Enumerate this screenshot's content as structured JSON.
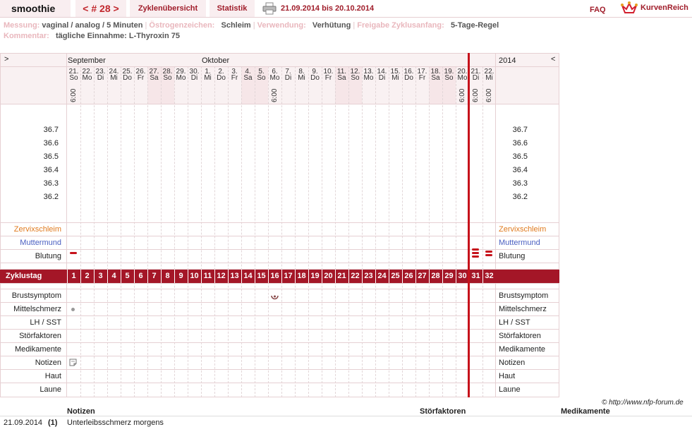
{
  "header": {
    "brand": "smoothie",
    "cycle_nav": {
      "prev": "<",
      "label": "# 28",
      "next": ">"
    },
    "tabs": [
      {
        "label": "Zyklenübersicht"
      },
      {
        "label": "Statistik"
      }
    ],
    "date_range": "21.09.2014 bis 20.10.2014",
    "faq": "FAQ",
    "logo_text": "KurvenReich"
  },
  "info": {
    "measurement_label": "Messung:",
    "measurement_value": "vaginal / analog / 5 Minuten",
    "estrogen_label": "Östrogenzeichen:",
    "estrogen_value": "Schleim",
    "use_label": "Verwendung:",
    "use_value": "Verhütung",
    "release_label": "Freigabe Zyklusanfang:",
    "release_value": "5-Tage-Regel",
    "comment_label": "Kommentar:",
    "comment_value": "tägliche Einnahme: L-Thyroxin 75"
  },
  "chart": {
    "nav_left": ">",
    "nav_right": "<",
    "year": "2014",
    "months": [
      "September",
      "Oktober"
    ],
    "days": [
      {
        "d": "21.",
        "w": "So",
        "t": "6:00"
      },
      {
        "d": "22.",
        "w": "Mo",
        "t": ""
      },
      {
        "d": "23.",
        "w": "Di",
        "t": ""
      },
      {
        "d": "24.",
        "w": "Mi",
        "t": ""
      },
      {
        "d": "25.",
        "w": "Do",
        "t": ""
      },
      {
        "d": "26.",
        "w": "Fr",
        "t": ""
      },
      {
        "d": "27.",
        "w": "Sa",
        "t": ""
      },
      {
        "d": "28.",
        "w": "So",
        "t": ""
      },
      {
        "d": "29.",
        "w": "Mo",
        "t": ""
      },
      {
        "d": "30.",
        "w": "Di",
        "t": ""
      },
      {
        "d": "1.",
        "w": "Mi",
        "t": ""
      },
      {
        "d": "2.",
        "w": "Do",
        "t": ""
      },
      {
        "d": "3.",
        "w": "Fr",
        "t": ""
      },
      {
        "d": "4.",
        "w": "Sa",
        "t": ""
      },
      {
        "d": "5.",
        "w": "So",
        "t": ""
      },
      {
        "d": "6.",
        "w": "Mo",
        "t": "6:00"
      },
      {
        "d": "7.",
        "w": "Di",
        "t": ""
      },
      {
        "d": "8.",
        "w": "Mi",
        "t": ""
      },
      {
        "d": "9.",
        "w": "Do",
        "t": ""
      },
      {
        "d": "10.",
        "w": "Fr",
        "t": ""
      },
      {
        "d": "11.",
        "w": "Sa",
        "t": ""
      },
      {
        "d": "12.",
        "w": "So",
        "t": ""
      },
      {
        "d": "13.",
        "w": "Mo",
        "t": ""
      },
      {
        "d": "14.",
        "w": "Di",
        "t": ""
      },
      {
        "d": "15.",
        "w": "Mi",
        "t": ""
      },
      {
        "d": "16.",
        "w": "Do",
        "t": ""
      },
      {
        "d": "17.",
        "w": "Fr",
        "t": ""
      },
      {
        "d": "18.",
        "w": "Sa",
        "t": ""
      },
      {
        "d": "19.",
        "w": "So",
        "t": ""
      },
      {
        "d": "20.",
        "w": "Mo",
        "t": "6:00"
      },
      {
        "d": "21.",
        "w": "Di",
        "t": "6:00"
      },
      {
        "d": "22.",
        "w": "Mi",
        "t": "6:00"
      }
    ],
    "weekend_days": [
      7,
      8,
      14,
      15,
      21,
      22,
      28,
      29
    ],
    "temperatures": [
      "36.7",
      "36.6",
      "36.5",
      "36.4",
      "36.3",
      "36.2"
    ],
    "rows_upper": [
      {
        "label": "Zervixschleim",
        "color": "#e07a1f"
      },
      {
        "label": "Muttermund",
        "color": "#4a5fc1"
      },
      {
        "label": "Blutung",
        "color": "#222222"
      }
    ],
    "cycle_day_label": "Zyklustag",
    "cycle_days": [
      "1",
      "2",
      "3",
      "4",
      "5",
      "6",
      "7",
      "8",
      "9",
      "10",
      "11",
      "12",
      "13",
      "14",
      "15",
      "16",
      "17",
      "18",
      "19",
      "20",
      "21",
      "22",
      "23",
      "24",
      "25",
      "26",
      "27",
      "28",
      "29",
      "30",
      "31",
      "32"
    ],
    "rows_lower": [
      "Brustsymptom",
      "Mittelschmerz",
      "LH / SST",
      "Störfaktoren",
      "Medikamente",
      "Notizen",
      "Haut",
      "Laune"
    ],
    "bleeding": [
      {
        "day": 1,
        "strength": 1
      },
      {
        "day": 31,
        "strength": 3
      },
      {
        "day": 32,
        "strength": 2
      }
    ],
    "breast_symptom_day": 16,
    "mittelschmerz_day": 1,
    "note_day": 1,
    "today_day": 30
  },
  "footer": {
    "credit": "© http://www.nfp-forum.de",
    "notes_header": "Notizen",
    "disturb_header": "Störfaktoren",
    "meds_header": "Medikamente",
    "note_entry": {
      "date": "21.09.2014",
      "cycle": "(1)",
      "text": "Unterleibsschmerz morgens"
    }
  }
}
